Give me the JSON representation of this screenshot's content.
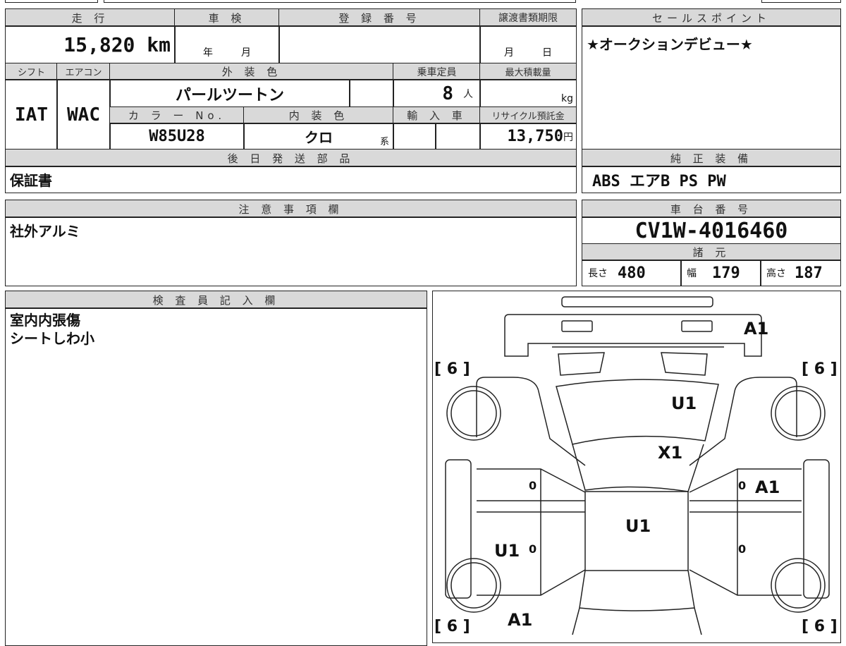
{
  "vehicle": {
    "mileage_label": "走 行",
    "mileage": "15,820",
    "mileage_unit": "km",
    "shaken_label": "車 検",
    "shaken_year_unit": "年",
    "shaken_month_unit": "月",
    "reg_no_label": "登 録 番 号",
    "transfer_deadline_label": "譲渡書類期限",
    "transfer_month_unit": "月",
    "transfer_day_unit": "日",
    "shift_label": "シフト",
    "shift": "IAT",
    "ac_label": "エアコン",
    "ac": "WAC",
    "exterior_color_label": "外 装 色",
    "exterior_color": "パールツートン",
    "capacity_label": "乗車定員",
    "capacity": "8",
    "capacity_unit": "人",
    "max_load_label": "最大積載量",
    "max_load_unit": "kg",
    "color_no_label": "カ ラ ー No.",
    "color_no": "W85U28",
    "interior_color_label": "内 装 色",
    "interior_color": "クロ",
    "interior_color_suffix": "系",
    "import_label": "輸 入 車",
    "recycle_label": "リサイクル預託金",
    "recycle_fee": "13,750",
    "recycle_unit": "円",
    "later_parts_label": "後 日 発 送 部 品",
    "later_parts": "保証書"
  },
  "sales_point": {
    "label": "セールスポイント",
    "text": "★オークションデビュー★"
  },
  "equipment": {
    "label": "純 正 装 備",
    "text": "ABS エアB PS PW"
  },
  "notes": {
    "label": "注 意 事 項 欄",
    "text": "社外アルミ"
  },
  "chassis": {
    "label": "車 台 番 号",
    "number": "CV1W-4016460"
  },
  "specs": {
    "label": "諸 元",
    "length_label": "長さ",
    "length": "480",
    "width_label": "幅",
    "width": "179",
    "height_label": "高さ",
    "height": "187"
  },
  "inspector": {
    "label": "検 査 員 記 入 欄",
    "text": "室内内張傷\nシートしわ小"
  },
  "diagram": {
    "tire_marks": [
      "[ 6 ]",
      "[ 6 ]",
      "[ 6 ]",
      "[ 6 ]"
    ],
    "damage": {
      "rear_bumper": "A1",
      "hood": "U1",
      "windshield": "X1",
      "roof": "U1",
      "right_front_door": "A1",
      "left_rear_door": "U1",
      "left_rear_quarter": "A1"
    },
    "door_marks": [
      "0",
      "0",
      "0",
      "0"
    ]
  }
}
